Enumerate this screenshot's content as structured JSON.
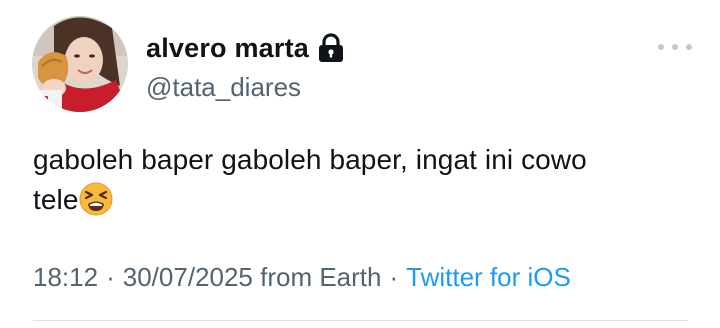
{
  "tweet": {
    "author": {
      "display_name": "alvero marta",
      "handle": "@tata_diares",
      "protected": true,
      "lock_icon": "lock-icon",
      "avatar_icon": "avatar"
    },
    "more_icon": "more-horizontal-icon",
    "text": {
      "line1": "gaboleh baper gaboleh baper, ingat ini cowo",
      "line2": "tele",
      "emoji": "tired-face-emoji"
    },
    "meta": {
      "time": "18:12",
      "separator1": "·",
      "date_location": "30/07/2025 from Earth",
      "separator2": "·",
      "source": "Twitter for iOS"
    },
    "colors": {
      "text": "#0f1419",
      "secondary": "#536471",
      "link": "#1d9bf0",
      "divider": "#dcdfe3"
    }
  }
}
